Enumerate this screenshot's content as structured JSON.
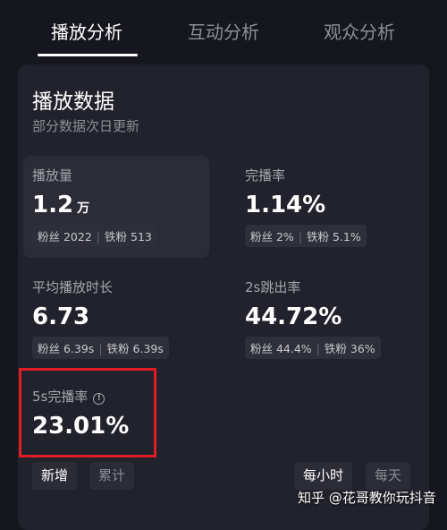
{
  "tabs": [
    {
      "label": "播放分析",
      "active": true
    },
    {
      "label": "互动分析",
      "active": false
    },
    {
      "label": "观众分析",
      "active": false
    }
  ],
  "card": {
    "title": "播放数据",
    "subtitle": "部分数据次日更新"
  },
  "metrics": {
    "plays": {
      "label": "播放量",
      "value": "1.2",
      "unit": "万",
      "fans": "粉丝 2022",
      "iron": "铁粉 513"
    },
    "completion": {
      "label": "完播率",
      "value": "1.14%",
      "fans": "粉丝 2%",
      "iron": "铁粉 5.1%"
    },
    "avg_duration": {
      "label": "平均播放时长",
      "value": "6.73",
      "fans": "粉丝 6.39s",
      "iron": "铁粉 6.39s"
    },
    "bounce_2s": {
      "label": "2s跳出率",
      "value": "44.72%",
      "fans": "粉丝 44.4%",
      "iron": "铁粉 36%"
    },
    "completion_5s": {
      "label": "5s完播率",
      "value": "23.01%"
    }
  },
  "chips": {
    "new": "新增",
    "cumulative": "累计",
    "hourly": "每小时",
    "daily": "每天"
  },
  "watermark": "知乎 @花哥教你玩抖音",
  "colors": {
    "background": "#16161e",
    "card": "#22222c",
    "highlight_border": "#e01d24"
  }
}
